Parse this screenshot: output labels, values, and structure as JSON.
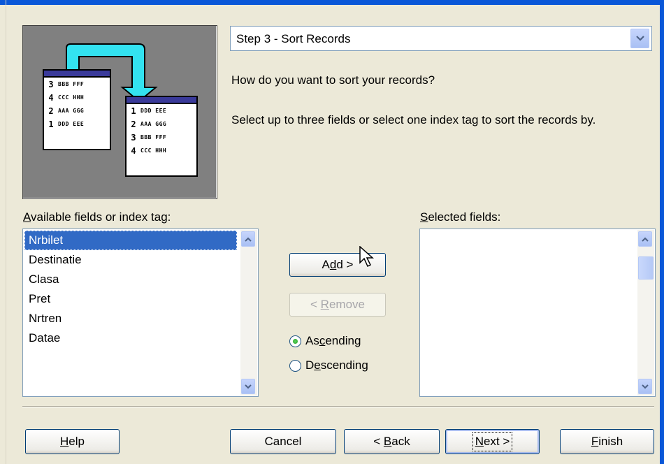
{
  "combo": {
    "value": "Step 3 - Sort Records"
  },
  "question": "How do you want to sort your records?",
  "instruction": "Select up to three fields or select one index tag to sort the records by.",
  "available": {
    "label_prefix": "",
    "label_accel": "A",
    "label_rest": "vailable fields or index tag:",
    "items": [
      "Nrbilet",
      "Destinatie",
      "Clasa",
      "Pret",
      "Nrtren",
      "Datae"
    ],
    "selected_index": 0
  },
  "selected": {
    "label_accel": "S",
    "label_rest": "elected fields:",
    "items": []
  },
  "buttons": {
    "add_pre": "A",
    "add_accel": "d",
    "add_post": "d >",
    "remove_pre": "< ",
    "remove_accel": "R",
    "remove_post": "emove",
    "help_accel": "H",
    "help_post": "elp",
    "cancel": "Cancel",
    "back_pre": "< ",
    "back_accel": "B",
    "back_post": "ack",
    "next_accel": "N",
    "next_post": "ext >",
    "finish_accel": "F",
    "finish_post": "inish"
  },
  "order": {
    "asc_pre": "As",
    "asc_accel": "c",
    "asc_post": "ending",
    "desc_pre": "D",
    "desc_accel": "e",
    "desc_post": "scending",
    "selected": "ascending"
  },
  "illustration": {
    "left_rows": [
      {
        "n": "3",
        "t": "BBB FFF"
      },
      {
        "n": "4",
        "t": "CCC HHH"
      },
      {
        "n": "2",
        "t": "AAA GGG"
      },
      {
        "n": "1",
        "t": "DDD EEE"
      }
    ],
    "right_rows": [
      {
        "n": "1",
        "t": "DDD EEE"
      },
      {
        "n": "2",
        "t": "AAA GGG"
      },
      {
        "n": "3",
        "t": "BBB FFF"
      },
      {
        "n": "4",
        "t": "CCC HHH"
      }
    ]
  }
}
